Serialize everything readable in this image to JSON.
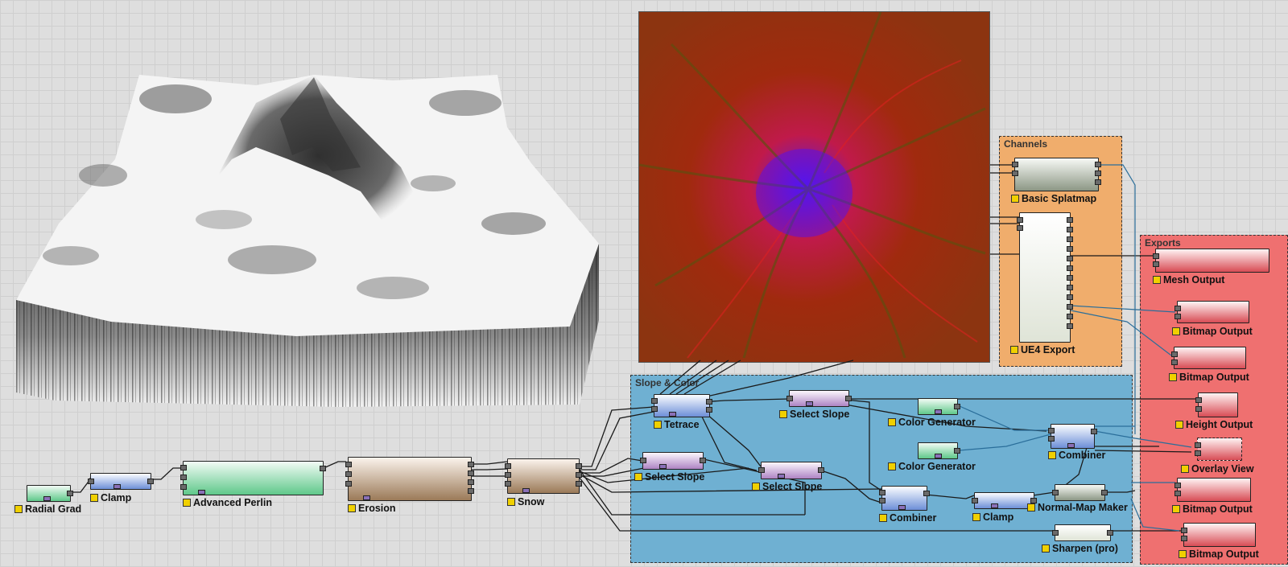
{
  "groups": {
    "slope": {
      "title": "Slope & Color",
      "color": "#6fb0d2"
    },
    "channels": {
      "title": "Channels",
      "color": "#f0ad6c"
    },
    "exports": {
      "title": "Exports",
      "color": "#ef7070"
    }
  },
  "nodes": {
    "radial_grad": "Radial Grad",
    "clamp1": "Clamp",
    "advanced_perlin": "Advanced Perlin",
    "erosion": "Erosion",
    "snow": "Snow",
    "tetrace": "Tetrace",
    "select_slope1": "Select Slope",
    "select_slope2": "Select Slope",
    "select_slope3": "Select Slope",
    "color_gen1": "Color Generator",
    "color_gen2": "Color Generator",
    "combiner1": "Combiner",
    "combiner2": "Combiner",
    "clamp2": "Clamp",
    "normal_map": "Normal-Map Maker",
    "sharpen": "Sharpen (pro)",
    "basic_splatmap": "Basic Splatmap",
    "ue4_export": "UE4 Export",
    "mesh_output": "Mesh Output",
    "bitmap_output1": "Bitmap Output",
    "bitmap_output2": "Bitmap Output",
    "height_output": "Height Output",
    "overlay_view": "Overlay View",
    "bitmap_output3": "Bitmap Output",
    "bitmap_output4": "Bitmap Output"
  },
  "colors": {
    "group_slope": "#6fb0d2",
    "group_channels": "#f0ad6c",
    "group_exports": "#ef7070",
    "label_marker": "#f0d000",
    "wire": "#1a1a1a",
    "wire_blue": "#2a6e9a"
  },
  "icons": [
    "terrain-3d-preview",
    "splatmap-preview"
  ]
}
